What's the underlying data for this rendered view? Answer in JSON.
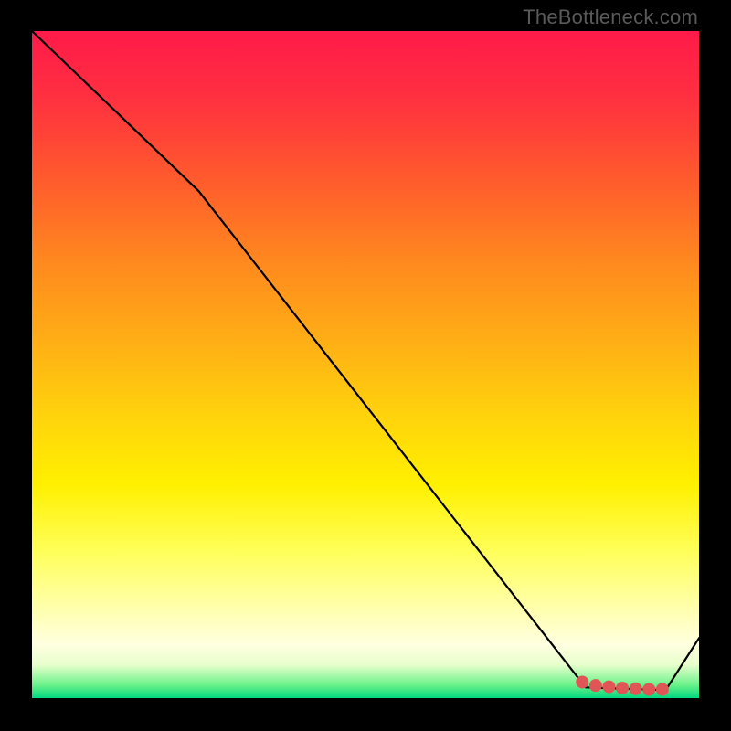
{
  "attribution": "TheBottleneck.com",
  "chart_data": {
    "type": "line",
    "title": "",
    "xlabel": "",
    "ylabel": "",
    "xlim": [
      0,
      100
    ],
    "ylim": [
      0,
      100
    ],
    "series": [
      {
        "name": "curve",
        "x": [
          0,
          25,
          83,
          95,
          100
        ],
        "y": [
          100,
          76,
          1.6,
          1.2,
          9
        ],
        "stroke": "#000000",
        "width": 2.2
      }
    ],
    "markers": {
      "name": "highlight-points",
      "color": "#e05555",
      "radius": 7,
      "points": [
        {
          "x": 82.5,
          "y": 2.4
        },
        {
          "x": 84.5,
          "y": 1.9
        },
        {
          "x": 86.5,
          "y": 1.7
        },
        {
          "x": 88.5,
          "y": 1.5
        },
        {
          "x": 90.5,
          "y": 1.4
        },
        {
          "x": 92.5,
          "y": 1.3
        },
        {
          "x": 94.5,
          "y": 1.3
        }
      ]
    }
  }
}
